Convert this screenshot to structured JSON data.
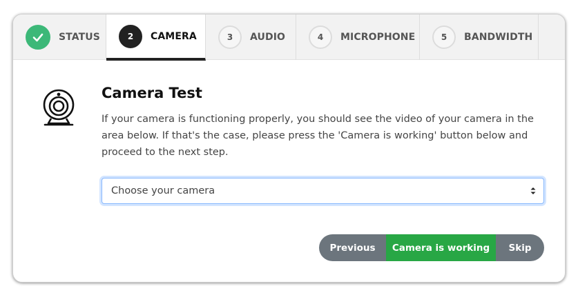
{
  "tabs": [
    {
      "number": "",
      "label": "STATUS",
      "state": "done"
    },
    {
      "number": "2",
      "label": "CAMERA",
      "state": "active"
    },
    {
      "number": "3",
      "label": "AUDIO",
      "state": "pending"
    },
    {
      "number": "4",
      "label": "MICROPHONE",
      "state": "pending"
    },
    {
      "number": "5",
      "label": "BANDWIDTH",
      "state": "pending"
    }
  ],
  "content": {
    "icon": "webcam-icon",
    "title": "Camera Test",
    "description": "If your camera is functioning properly, you should see the video of your camera in the area below. If that's the case, please press the 'Camera is working' button below and proceed to the next step."
  },
  "camera_select": {
    "selected": "Choose your camera"
  },
  "buttons": {
    "previous": "Previous",
    "working": "Camera is working",
    "skip": "Skip"
  },
  "colors": {
    "done": "#3cb878",
    "active": "#222222",
    "success": "#28a745",
    "secondary": "#6c757d",
    "focus": "#86b7fe"
  }
}
